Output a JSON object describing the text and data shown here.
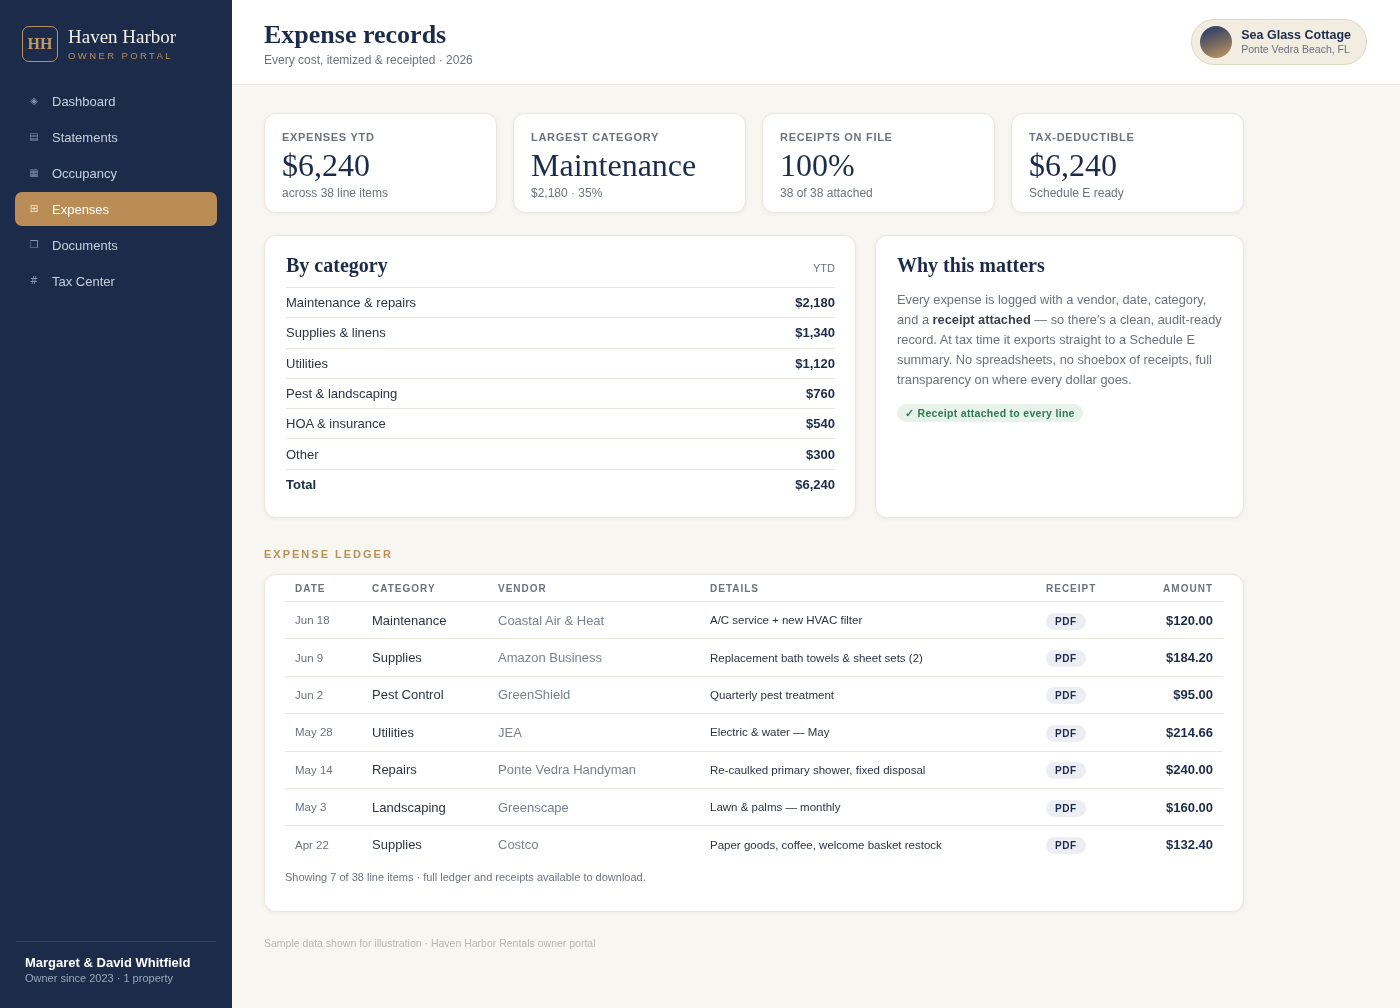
{
  "sidebar": {
    "logo": {
      "mark": "HH",
      "name": "Haven Harbor",
      "tagline": "OWNER PORTAL"
    },
    "nav": [
      {
        "icon": "◈",
        "label": "Dashboard",
        "selected": false
      },
      {
        "icon": "▤",
        "label": "Statements",
        "selected": false
      },
      {
        "icon": "▦",
        "label": "Occupancy",
        "selected": false
      },
      {
        "icon": "⊞",
        "label": "Expenses",
        "selected": true
      },
      {
        "icon": "❐",
        "label": "Documents",
        "selected": false
      },
      {
        "icon": "#",
        "label": "Tax Center",
        "selected": false
      }
    ],
    "user": {
      "name": "Margaret & David Whitfield",
      "meta": "Owner since 2023 · 1 property"
    }
  },
  "header": {
    "title": "Expense records",
    "subtitle": "Every cost, itemized & receipted · 2026",
    "property": {
      "name": "Sea Glass Cottage",
      "location": "Ponte Vedra Beach, FL"
    }
  },
  "stats": [
    {
      "label": "EXPENSES YTD",
      "value": "$6,240",
      "note": "across 38 line items"
    },
    {
      "label": "LARGEST CATEGORY",
      "value": "Maintenance",
      "note": "$2,180 · 35%"
    },
    {
      "label": "RECEIPTS ON FILE",
      "value": "100%",
      "note": "38 of 38 attached"
    },
    {
      "label": "TAX-DEDUCTIBLE",
      "value": "$6,240",
      "note": "Schedule E ready"
    }
  ],
  "by_category": {
    "title": "By category",
    "period": "YTD",
    "rows": [
      {
        "kind": "item",
        "name": "Maintenance & repairs",
        "amount": "$2,180"
      },
      {
        "kind": "item",
        "name": "Supplies & linens",
        "amount": "$1,340"
      },
      {
        "kind": "item",
        "name": "Utilities",
        "amount": "$1,120"
      },
      {
        "kind": "item",
        "name": "Pest & landscaping",
        "amount": "$760"
      },
      {
        "kind": "item",
        "name": "HOA & insurance",
        "amount": "$540"
      },
      {
        "kind": "item",
        "name": "Other",
        "amount": "$300"
      },
      {
        "kind": "total",
        "name": "Total",
        "amount": "$6,240"
      }
    ]
  },
  "why": {
    "title": "Why this matters",
    "body": "Every expense is logged with a vendor, date, category, and a **receipt attached** — so there's a clean, audit-ready record. At tax time it exports straight to a Schedule E summary. No spreadsheets, no shoebox of receipts, full transparency on where every dollar goes.",
    "badge": "✓ Receipt attached to every line"
  },
  "ledger": {
    "title": "EXPENSE LEDGER",
    "columns": [
      "DATE",
      "CATEGORY",
      "VENDOR",
      "DETAILS",
      "RECEIPT",
      "AMOUNT"
    ],
    "rows": [
      {
        "date": "Jun 18",
        "category": "Maintenance",
        "vendor": "Coastal Air & Heat",
        "details": "A/C service + new HVAC filter",
        "receipt": "PDF",
        "amount": "$120.00"
      },
      {
        "date": "Jun 9",
        "category": "Supplies",
        "vendor": "Amazon Business",
        "details": "Replacement bath towels & sheet sets (2)",
        "receipt": "PDF",
        "amount": "$184.20"
      },
      {
        "date": "Jun 2",
        "category": "Pest Control",
        "vendor": "GreenShield",
        "details": "Quarterly pest treatment",
        "receipt": "PDF",
        "amount": "$95.00"
      },
      {
        "date": "May 28",
        "category": "Utilities",
        "vendor": "JEA",
        "details": "Electric & water — May",
        "receipt": "PDF",
        "amount": "$214.66"
      },
      {
        "date": "May 14",
        "category": "Repairs",
        "vendor": "Ponte Vedra Handyman",
        "details": "Re-caulked primary shower, fixed disposal",
        "receipt": "PDF",
        "amount": "$240.00"
      },
      {
        "date": "May 3",
        "category": "Landscaping",
        "vendor": "Greenscape",
        "details": "Lawn & palms — monthly",
        "receipt": "PDF",
        "amount": "$160.00"
      },
      {
        "date": "Apr 22",
        "category": "Supplies",
        "vendor": "Costco",
        "details": "Paper goods, coffee, welcome basket restock",
        "receipt": "PDF",
        "amount": "$132.40"
      }
    ],
    "note": "Showing 7 of 38 line items · full ledger and receipts available to download."
  },
  "footer": "Sample data shown for illustration · Haven Harbor Rentals owner portal"
}
